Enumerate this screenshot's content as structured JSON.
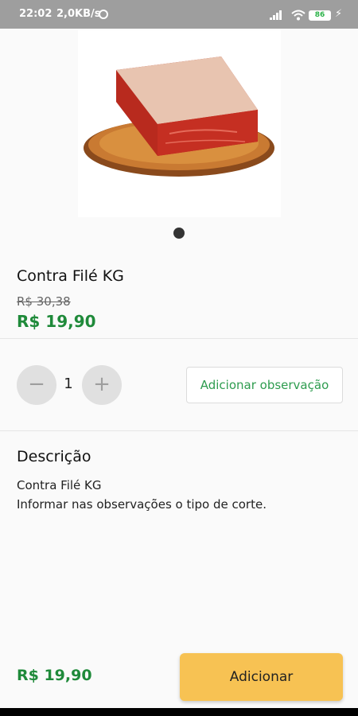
{
  "status_bar": {
    "time": "22:02",
    "speed": "2,0KB/s",
    "battery": "86"
  },
  "product": {
    "name": "Contra Filé KG",
    "old_price": "R$ 30,38",
    "price": "R$ 19,90",
    "image_icon": "meat-on-board-image"
  },
  "quantity": {
    "value": "1",
    "minus_icon": "minus-icon",
    "plus_icon": "plus-icon"
  },
  "observation_button": "Adicionar observação",
  "description": {
    "title": "Descrição",
    "line1": "Contra Filé KG",
    "line2": "Informar nas observações o tipo de corte."
  },
  "footer": {
    "total": "R$ 19,90",
    "add_button": "Adicionar"
  },
  "colors": {
    "price_green": "#1f8a3a",
    "accent_yellow": "#f7c253",
    "obs_green": "#2e9c4f"
  }
}
